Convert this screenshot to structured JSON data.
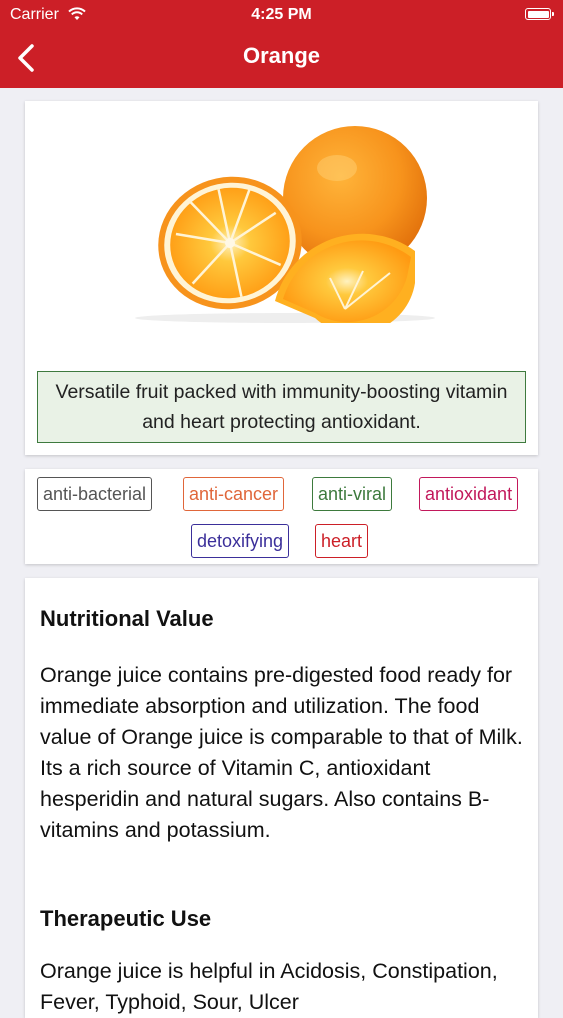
{
  "status_bar": {
    "carrier": "Carrier",
    "time": "4:25 PM"
  },
  "nav": {
    "title": "Orange"
  },
  "hero": {
    "image_icon": "orange-fruit-image",
    "description": "Versatile fruit packed with immunity-boosting vitamin and heart protecting antioxidant."
  },
  "tags": [
    {
      "label": "anti-bacterial",
      "color": "#555555"
    },
    {
      "label": "anti-cancer",
      "color": "#e0663a"
    },
    {
      "label": "anti-viral",
      "color": "#3d7a3d"
    },
    {
      "label": "antioxidant",
      "color": "#c2185b"
    },
    {
      "label": "detoxifying",
      "color": "#3b2f9a"
    },
    {
      "label": "heart",
      "color": "#cc1f27"
    }
  ],
  "sections": {
    "nutritional_heading": "Nutritional Value",
    "nutritional_text": "Orange juice contains pre-digested food ready for immediate absorption and utilization. The food value of Orange juice is comparable to that of Milk. Its a rich source of Vitamin C, antioxidant hesperidin and natural sugars. Also contains B-vitamins and potassium.",
    "therapeutic_heading": "Therapeutic Use",
    "therapeutic_text": "Orange juice is helpful in Acidosis, Constipation, Fever, Typhoid, Sour, Ulcer"
  },
  "colors": {
    "brand": "#cc1f27",
    "description_bg": "#e9f2e6",
    "description_border": "#3e7a3e"
  }
}
